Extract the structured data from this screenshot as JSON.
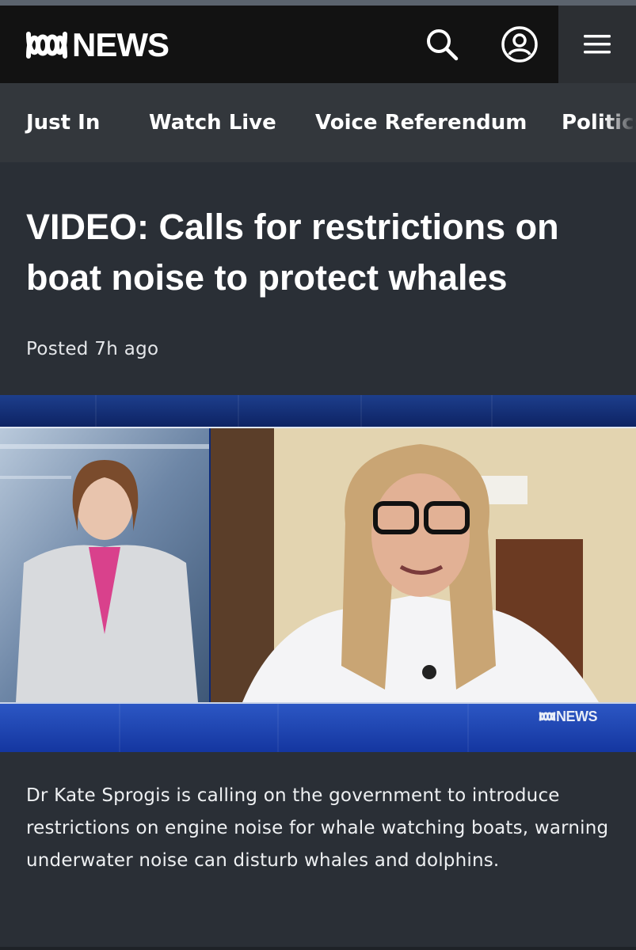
{
  "header": {
    "logo_text": "NEWS",
    "search_label": "Search",
    "account_label": "Account",
    "menu_label": "Menu"
  },
  "nav": {
    "items": [
      {
        "label": "Just In"
      },
      {
        "label": "Watch Live"
      },
      {
        "label": "Voice Referendum"
      },
      {
        "label": "Politics"
      }
    ]
  },
  "article": {
    "title": "VIDEO: Calls for restrictions on boat noise to protect whales",
    "posted": "Posted 7h ago",
    "summary": "Dr Kate Sprogis is calling on the government to introduce restrictions on engine noise for whale watching boats, warning underwater noise can disturb whales and dolphins."
  },
  "video": {
    "watermark": "NEWS"
  },
  "colors": {
    "header_bg": "#121212",
    "nav_bg": "#33373c",
    "page_bg": "#2a2f36",
    "video_band": "#1436a0"
  }
}
